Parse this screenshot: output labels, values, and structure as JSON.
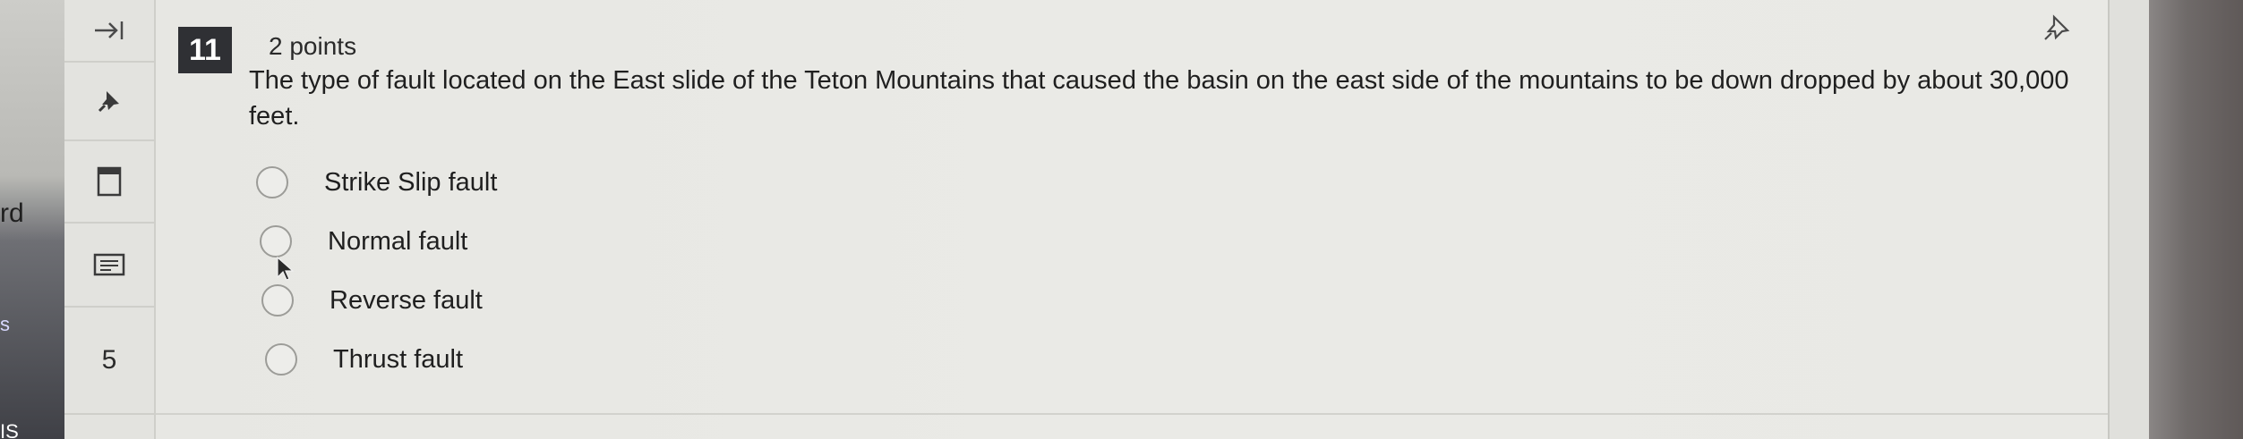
{
  "left_fragments": {
    "frag_a": "rd",
    "frag_b": "s",
    "frag_c": "IS"
  },
  "toolbar": {
    "collapse_icon": "arrow-right-bar-icon",
    "pin_icon": "pushpin-icon",
    "flag_icon": "bookmark-flag-icon",
    "calc_icon": "calculator-icon",
    "question_number": "5"
  },
  "question": {
    "number": "11",
    "points": "2 points",
    "pin_icon": "pushpin-outline-icon",
    "text": "The type of fault located on the East slide of the Teton Mountains that caused the basin on the east side of the mountains to be down dropped by about 30,000 feet.",
    "options": [
      {
        "label": "Strike Slip fault"
      },
      {
        "label": "Normal fault"
      },
      {
        "label": "Reverse fault"
      },
      {
        "label": "Thrust fault"
      }
    ]
  },
  "colors": {
    "qnum_bg": "#2f3034",
    "card_bg": "#eaeae6",
    "text": "#1f1f1f"
  }
}
